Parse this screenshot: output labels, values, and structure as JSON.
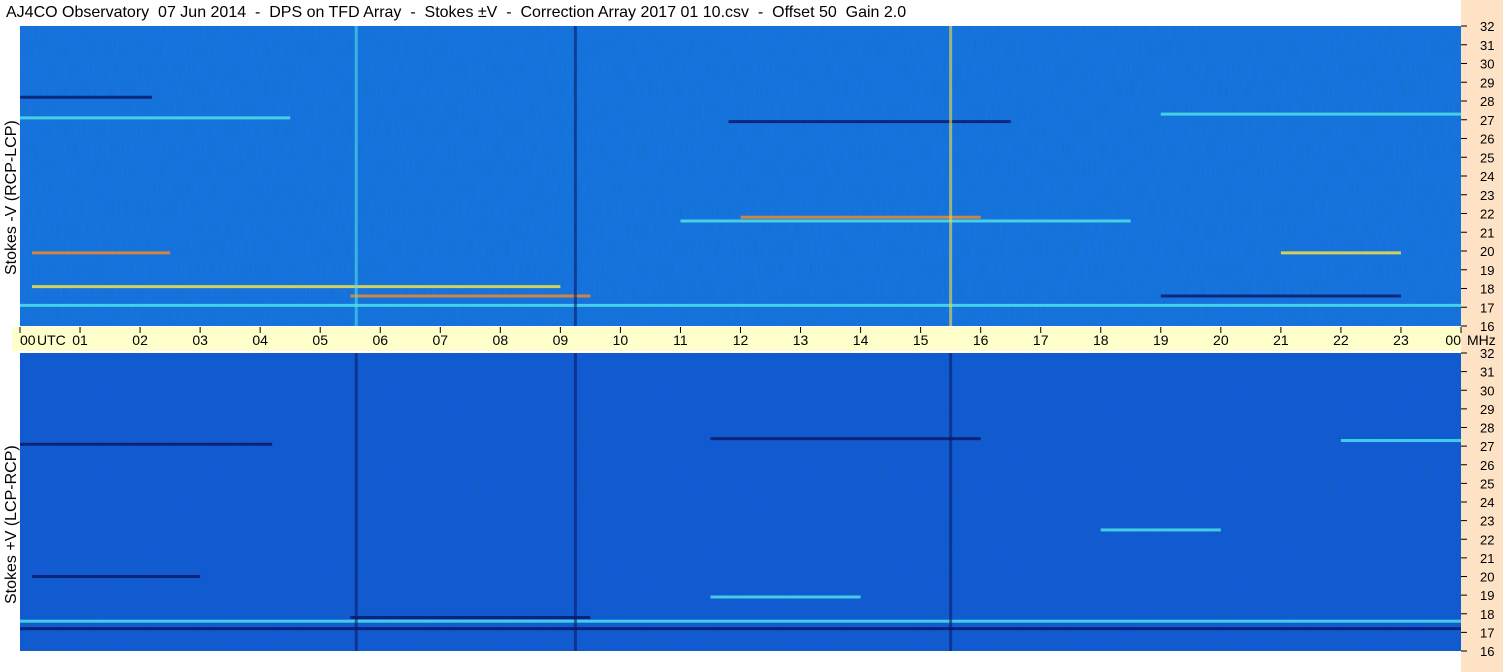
{
  "header": {
    "title": "AJ4CO Observatory  07 Jun 2014  -  DPS on TFD Array  -  Stokes ±V  -  Correction Array 2017 01 10.csv  -  Offset 50  Gain 2.0"
  },
  "colors": {
    "plot_top": "#1a74e8",
    "plot_bottom": "#1557da",
    "time_bar": "#ffffcc",
    "right_strip": "#fde2c5",
    "emission_cyan": "#4fe0e8",
    "emission_yellow": "#f5e04a",
    "emission_orange": "#f08a2a",
    "emission_dark": "#0a1a6a"
  },
  "chart_data": {
    "type": "heatmap",
    "panels": [
      {
        "ylabel": "Stokes -V (RCP-LCP)",
        "ylim": [
          16,
          32
        ]
      },
      {
        "ylabel": "Stokes +V (LCP-RCP)",
        "ylim": [
          16,
          32
        ]
      }
    ],
    "x_ticks": [
      "00",
      "01",
      "02",
      "03",
      "04",
      "05",
      "06",
      "07",
      "08",
      "09",
      "10",
      "11",
      "12",
      "13",
      "14",
      "15",
      "16",
      "17",
      "18",
      "19",
      "20",
      "21",
      "22",
      "23",
      "00"
    ],
    "x_unit": "UTC",
    "xlim": [
      0,
      24
    ],
    "y_ticks": [
      16,
      17,
      18,
      19,
      20,
      21,
      22,
      23,
      24,
      25,
      26,
      27,
      28,
      29,
      30,
      31,
      32
    ],
    "y_unit": "MHz",
    "features": [
      {
        "panel": 0,
        "mhz": 28.2,
        "t0": 0.0,
        "t1": 2.2,
        "color": "emission_dark"
      },
      {
        "panel": 0,
        "mhz": 27.1,
        "t0": 0.0,
        "t1": 4.5,
        "color": "emission_cyan"
      },
      {
        "panel": 0,
        "mhz": 26.9,
        "t0": 11.8,
        "t1": 16.5,
        "color": "emission_dark"
      },
      {
        "panel": 0,
        "mhz": 27.3,
        "t0": 19.0,
        "t1": 24.0,
        "color": "emission_cyan"
      },
      {
        "panel": 0,
        "mhz": 21.8,
        "t0": 12.0,
        "t1": 16.0,
        "color": "emission_orange"
      },
      {
        "panel": 0,
        "mhz": 21.6,
        "t0": 11.0,
        "t1": 18.5,
        "color": "emission_cyan"
      },
      {
        "panel": 0,
        "mhz": 19.9,
        "t0": 0.2,
        "t1": 2.5,
        "color": "emission_orange"
      },
      {
        "panel": 0,
        "mhz": 19.9,
        "t0": 21.0,
        "t1": 23.0,
        "color": "emission_yellow"
      },
      {
        "panel": 0,
        "mhz": 18.1,
        "t0": 0.2,
        "t1": 9.0,
        "color": "emission_yellow"
      },
      {
        "panel": 0,
        "mhz": 17.6,
        "t0": 5.5,
        "t1": 9.5,
        "color": "emission_orange"
      },
      {
        "panel": 0,
        "mhz": 17.1,
        "t0": 0.0,
        "t1": 24.0,
        "color": "emission_cyan"
      },
      {
        "panel": 0,
        "mhz": 17.6,
        "t0": 19.0,
        "t1": 23.0,
        "color": "emission_dark"
      },
      {
        "panel": 1,
        "mhz": 27.1,
        "t0": 0.0,
        "t1": 4.2,
        "color": "emission_dark"
      },
      {
        "panel": 1,
        "mhz": 27.4,
        "t0": 11.5,
        "t1": 16.0,
        "color": "emission_dark"
      },
      {
        "panel": 1,
        "mhz": 27.3,
        "t0": 22.0,
        "t1": 24.0,
        "color": "emission_cyan"
      },
      {
        "panel": 1,
        "mhz": 22.5,
        "t0": 18.0,
        "t1": 20.0,
        "color": "emission_cyan"
      },
      {
        "panel": 1,
        "mhz": 20.0,
        "t0": 0.2,
        "t1": 3.0,
        "color": "emission_dark"
      },
      {
        "panel": 1,
        "mhz": 18.9,
        "t0": 11.5,
        "t1": 14.0,
        "color": "emission_cyan"
      },
      {
        "panel": 1,
        "mhz": 17.8,
        "t0": 5.5,
        "t1": 9.5,
        "color": "emission_dark"
      },
      {
        "panel": 1,
        "mhz": 17.6,
        "t0": 0.0,
        "t1": 24.0,
        "color": "emission_cyan"
      },
      {
        "panel": 1,
        "mhz": 17.2,
        "t0": 0.0,
        "t1": 24.0,
        "color": "emission_dark"
      }
    ],
    "vertical_features": [
      {
        "panel": 0,
        "t": 9.25,
        "color": "emission_dark"
      },
      {
        "panel": 0,
        "t": 15.5,
        "color": "emission_yellow"
      },
      {
        "panel": 0,
        "t": 5.6,
        "color": "emission_cyan"
      },
      {
        "panel": 1,
        "t": 9.25,
        "color": "emission_dark"
      },
      {
        "panel": 1,
        "t": 15.5,
        "color": "emission_dark"
      },
      {
        "panel": 1,
        "t": 5.6,
        "color": "emission_dark"
      }
    ]
  }
}
